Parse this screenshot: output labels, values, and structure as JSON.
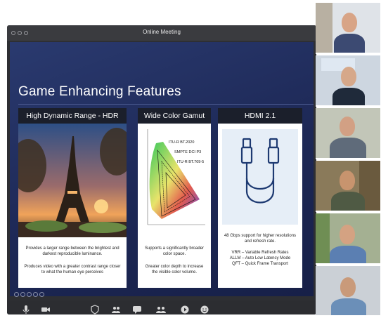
{
  "window": {
    "title": "Online Meeting"
  },
  "slide": {
    "title": "Game Enhancing Features",
    "cards": [
      {
        "heading": "High Dynamic Range - HDR",
        "text1": "Provides a larger range between the brightest and darkest reproducible luminance.",
        "text2": "Produces video with a greater contrast range closer to what the human eye perceives"
      },
      {
        "heading": "Wide Color Gamut",
        "labels": [
          "ITU-R BT.2020",
          "SMPTE DCI P3",
          "ITU-R BT.709-5"
        ],
        "text1": "Supports a significantly broader color space.",
        "text2": "Greater color depth to increase the visible color volume."
      },
      {
        "heading": "HDMI 2.1",
        "text1": "48 Gbps support for higher resolutions and refresh rate.",
        "features": [
          "VRR – Variable Refresh Rates",
          "ALLM – Auto Low Latency Mode",
          "QFT – Quick Frame Transport"
        ]
      }
    ]
  },
  "toolbar": {
    "icons": [
      "microphone-icon",
      "video-camera-icon",
      "security-shield-icon",
      "participants-icon",
      "chat-icon",
      "share-icon",
      "record-icon",
      "reactions-icon"
    ]
  },
  "participants": [
    {
      "name": "participant-1",
      "shirt": "#3c4a72",
      "bg": "#d9dde3"
    },
    {
      "name": "participant-2",
      "shirt": "#1f2a3a",
      "bg": "#c7d2de"
    },
    {
      "name": "participant-3",
      "shirt": "#5f6b7a",
      "bg": "#bfc4b6"
    },
    {
      "name": "participant-4",
      "shirt": "#4f5a44",
      "bg": "#8a7a5a"
    },
    {
      "name": "participant-5",
      "shirt": "#5b7fb2",
      "bg": "#9fae8e"
    },
    {
      "name": "participant-6",
      "shirt": "#6b8fb8",
      "bg": "#c8ccd2"
    }
  ]
}
